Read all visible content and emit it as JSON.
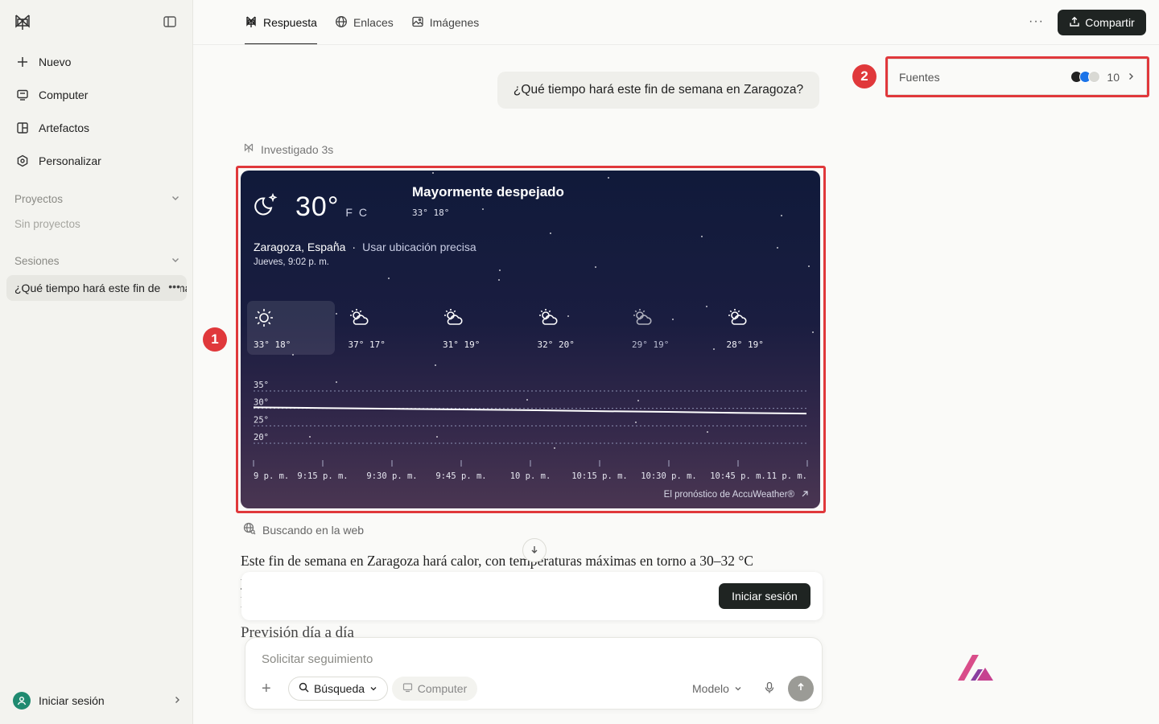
{
  "sidebar": {
    "nav": [
      {
        "label": "Nuevo",
        "icon": "plus-icon"
      },
      {
        "label": "Computer",
        "icon": "computer-icon"
      },
      {
        "label": "Artefactos",
        "icon": "artifacts-icon"
      },
      {
        "label": "Personalizar",
        "icon": "customize-icon"
      }
    ],
    "projects": {
      "label": "Proyectos",
      "empty": "Sin proyectos"
    },
    "sessions": {
      "label": "Sesiones",
      "items": [
        "¿Qué tiempo hará este fin de semana en Zaragoza?"
      ]
    },
    "login": "Iniciar sesión"
  },
  "tabs": [
    "Respuesta",
    "Enlaces",
    "Imágenes"
  ],
  "header": {
    "share": "Compartir"
  },
  "question": "¿Qué tiempo hará este fin de semana en Zaragoza?",
  "sources": {
    "label": "Fuentes",
    "count": "10"
  },
  "annotations": {
    "one": "1",
    "two": "2"
  },
  "status": {
    "researched": "Investigado 3s",
    "searching": "Buscando en la web"
  },
  "weather": {
    "temp": "30°",
    "units": "F C",
    "condition": "Mayormente despejado",
    "hi_lo": "33° 18°",
    "location": "Zaragoza, España",
    "separator": "·",
    "precise": "Usar ubicación precisa",
    "time": "Jueves, 9:02 p. m.",
    "days": [
      {
        "icon": "sun-icon",
        "temps": "33° 18°",
        "selected": true
      },
      {
        "icon": "partly-cloudy-icon",
        "temps": "37° 17°"
      },
      {
        "icon": "partly-cloudy-icon",
        "temps": "31° 19°"
      },
      {
        "icon": "partly-cloudy-icon",
        "temps": "32° 20°"
      },
      {
        "icon": "partly-cloudy-icon",
        "temps": "29° 19°",
        "dim": true
      },
      {
        "icon": "partly-cloudy-icon",
        "temps": "28° 19°"
      }
    ],
    "attribution": "El pronóstico de AccuWeather®"
  },
  "chart_data": {
    "type": "line",
    "categories": [
      "9 p. m.",
      "9:15 p. m.",
      "9:30 p. m.",
      "9:45 p. m.",
      "10 p. m.",
      "10:15 p. m.",
      "10:30 p. m.",
      "10:45 p. m.",
      "11 p. m."
    ],
    "values": [
      30.3,
      30.1,
      29.9,
      29.7,
      29.5,
      29.2,
      29.0,
      28.7,
      28.5
    ],
    "ylim": [
      18,
      37
    ],
    "yticks": [
      "35°",
      "30°",
      "25°",
      "20°"
    ],
    "ytick_values": [
      35,
      30,
      25,
      20
    ],
    "grid": true
  },
  "answer": {
    "text": "Este fin de semana en Zaragoza hará calor, con temperaturas máximas en torno a 30–32 °C",
    "line2": "y",
    "line3": "l",
    "heading": "Previsión día a día"
  },
  "login_card": {
    "button": "Iniciar sesión"
  },
  "composer": {
    "placeholder": "Solicitar seguimiento",
    "search": "Búsqueda",
    "computer": "Computer",
    "model": "Modelo"
  }
}
